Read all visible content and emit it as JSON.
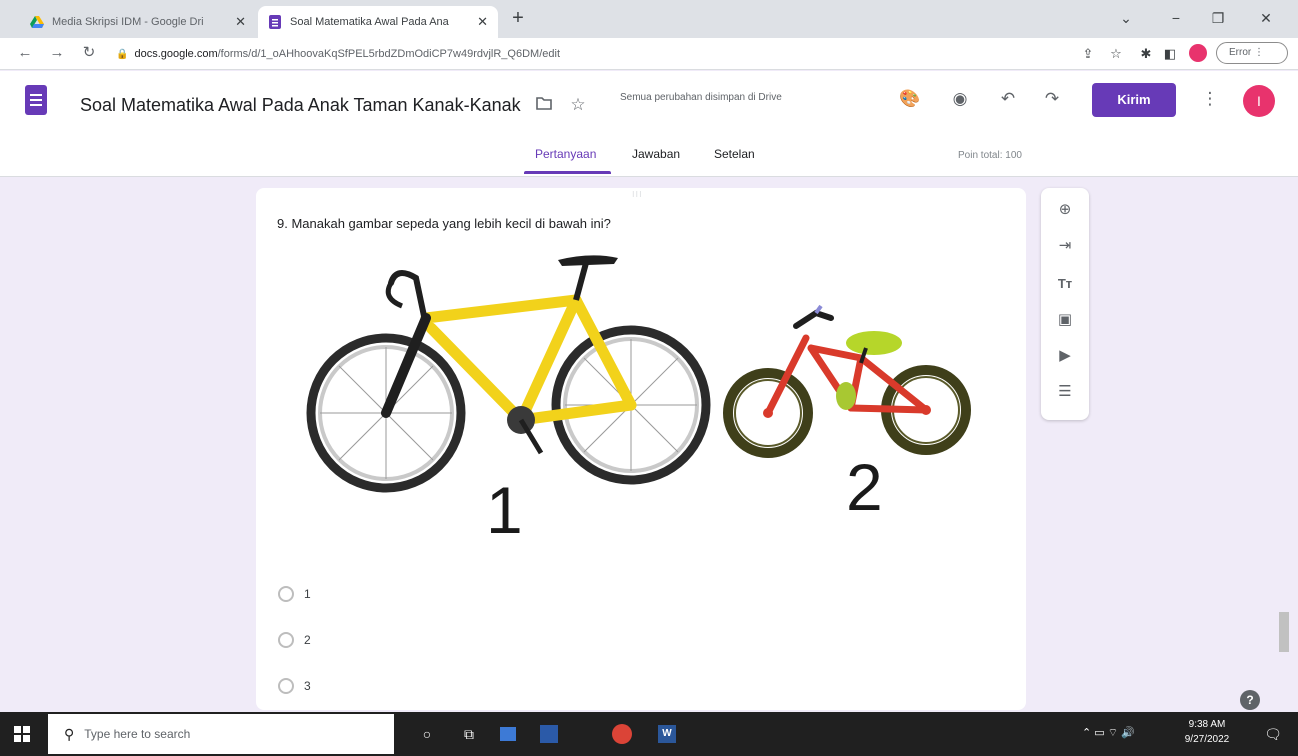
{
  "browser": {
    "tabs": [
      {
        "title": "Media Skripsi IDM - Google Dri",
        "icon": "google-drive-icon",
        "active": false
      },
      {
        "title": "Soal Matematika Awal Pada Ana",
        "icon": "google-forms-icon",
        "active": true
      }
    ],
    "address": {
      "host": "docs.google.com",
      "path": "/forms/d/1_oAHhoovaKqSfPEL5rbdZDmOdiCP7w49rdvjlR_Q6DM/edit"
    },
    "error_label": "Error"
  },
  "form": {
    "title": "Soal Matematika Awal Pada Anak Taman Kanak-Kanak",
    "save_status": "Semua perubahan disimpan di Drive",
    "send_label": "Kirim",
    "avatar_letter": "I",
    "nav_tabs": [
      {
        "label": "Pertanyaan",
        "active": true
      },
      {
        "label": "Jawaban",
        "active": false
      },
      {
        "label": "Setelan",
        "active": false
      }
    ],
    "points_total": "Poin total: 100",
    "accent_color": "#673ab7",
    "background_color": "#f0ebf8"
  },
  "question": {
    "text": "9. Manakah gambar sepeda yang lebih kecil di bawah ini?",
    "image_labels": [
      "1",
      "2"
    ],
    "options": [
      "1",
      "2",
      "3"
    ]
  },
  "side_toolbar": {
    "icons": [
      "add-question-icon",
      "import-questions-icon",
      "add-title-icon",
      "add-image-icon",
      "add-video-icon",
      "add-section-icon"
    ]
  },
  "taskbar": {
    "search_placeholder": "Type here to search",
    "time": "9:38 AM",
    "date": "9/27/2022"
  }
}
